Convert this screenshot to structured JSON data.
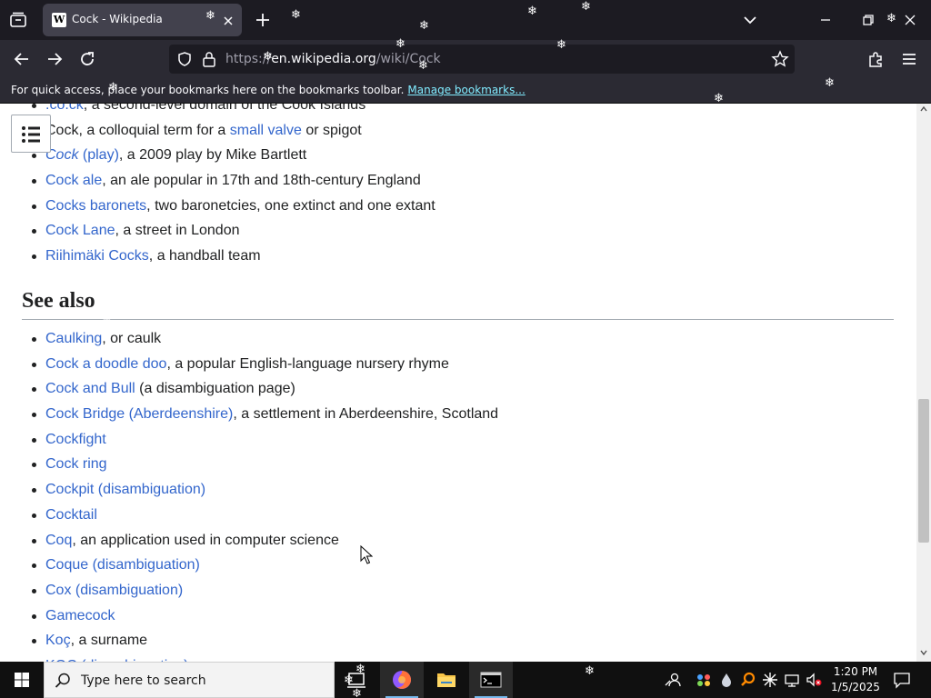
{
  "browser": {
    "tab": {
      "title": "Cock - Wikipedia",
      "favicon": "W"
    },
    "url": {
      "scheme": "https://",
      "host": "en.wikipedia.org",
      "path": "/wiki/Cock"
    },
    "bookmarks_bar": {
      "message": "For quick access, place your bookmarks here on the bookmarks toolbar.",
      "link": "Manage bookmarks..."
    }
  },
  "article": {
    "top_items": [
      {
        "link": ".co.ck",
        "rest": ", a second-level domain of the Cook Islands"
      },
      {
        "link": "",
        "plain": "Cock",
        "rest": ", a colloquial term for a ",
        "link2": "small valve",
        "rest2": " or spigot"
      },
      {
        "link": "Cock (play)",
        "rest": ", a 2009 play by Mike Bartlett",
        "italic_part": "Cock"
      },
      {
        "link": "Cock ale",
        "rest": ", an ale popular in 17th and 18th-century England"
      },
      {
        "link": "Cocks baronets",
        "rest": ", two baronetcies, one extinct and one extant"
      },
      {
        "link": "Cock Lane",
        "rest": ", a street in London"
      },
      {
        "link": "Riihimäki Cocks",
        "rest": ", a handball team"
      }
    ],
    "see_also": {
      "heading": "See also",
      "items": [
        {
          "link": "Caulking",
          "rest": ", or caulk"
        },
        {
          "link": "Cock a doodle doo",
          "rest": ", a popular English-language nursery rhyme"
        },
        {
          "link": "Cock and Bull",
          "rest": " (a disambiguation page)"
        },
        {
          "link": "Cock Bridge (Aberdeenshire)",
          "rest": ", a settlement in Aberdeenshire, Scotland"
        },
        {
          "link": "Cockfight",
          "rest": ""
        },
        {
          "link": "Cock ring",
          "rest": ""
        },
        {
          "link": "Cockpit (disambiguation)",
          "rest": ""
        },
        {
          "link": "Cocktail",
          "rest": ""
        },
        {
          "link": "Coq",
          "rest": ", an application used in computer science"
        },
        {
          "link": "Coque (disambiguation)",
          "rest": ""
        },
        {
          "link": "Cox (disambiguation)",
          "rest": ""
        },
        {
          "link": "Gamecock",
          "rest": ""
        },
        {
          "link": "Koç",
          "rest": ", a surname"
        },
        {
          "link": "KOC (disambiguation)",
          "rest": ""
        }
      ]
    }
  },
  "taskbar": {
    "search_placeholder": "Type here to search",
    "time": "1:20 PM",
    "date": "1/5/2025",
    "apps": [
      "task-view-icon",
      "firefox-icon",
      "file-explorer-icon",
      "terminal-icon"
    ]
  },
  "colors": {
    "link": "#3366cc",
    "text": "#202122",
    "chrome_dark": "#1c1b22",
    "chrome_mid": "#2b2a33",
    "bookmark_link": "#80ebff"
  }
}
